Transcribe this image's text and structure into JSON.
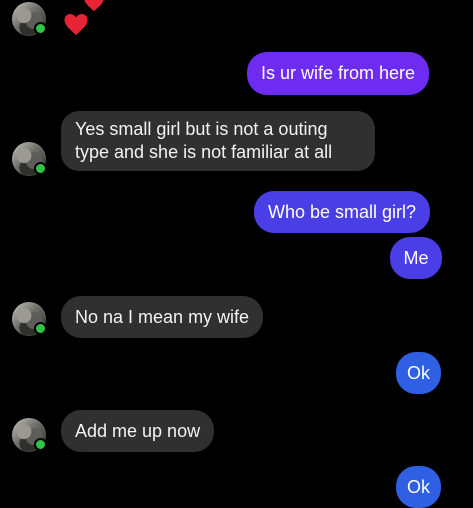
{
  "reactions": {
    "heart_count_visible": 2,
    "heart_color": "#e52535"
  },
  "colors": {
    "background": "#000000",
    "received_bubble": "#303030",
    "sent_top": "#6e2cf2",
    "sent_mid": "#4a3fe6",
    "sent_bottom": "#2f5fe3",
    "online_dot": "#31c443"
  },
  "messages": [
    {
      "direction": "sent",
      "text": "Is ur wife from here"
    },
    {
      "direction": "received",
      "text": "Yes small girl but is not a outing type and she is not familiar at all"
    },
    {
      "direction": "sent",
      "text": "Who be small girl?"
    },
    {
      "direction": "sent",
      "text": "Me"
    },
    {
      "direction": "received",
      "text": "No na I mean my wife"
    },
    {
      "direction": "sent",
      "text": "Ok"
    },
    {
      "direction": "received",
      "text": "Add me up now"
    },
    {
      "direction": "sent",
      "text": "Ok"
    }
  ]
}
